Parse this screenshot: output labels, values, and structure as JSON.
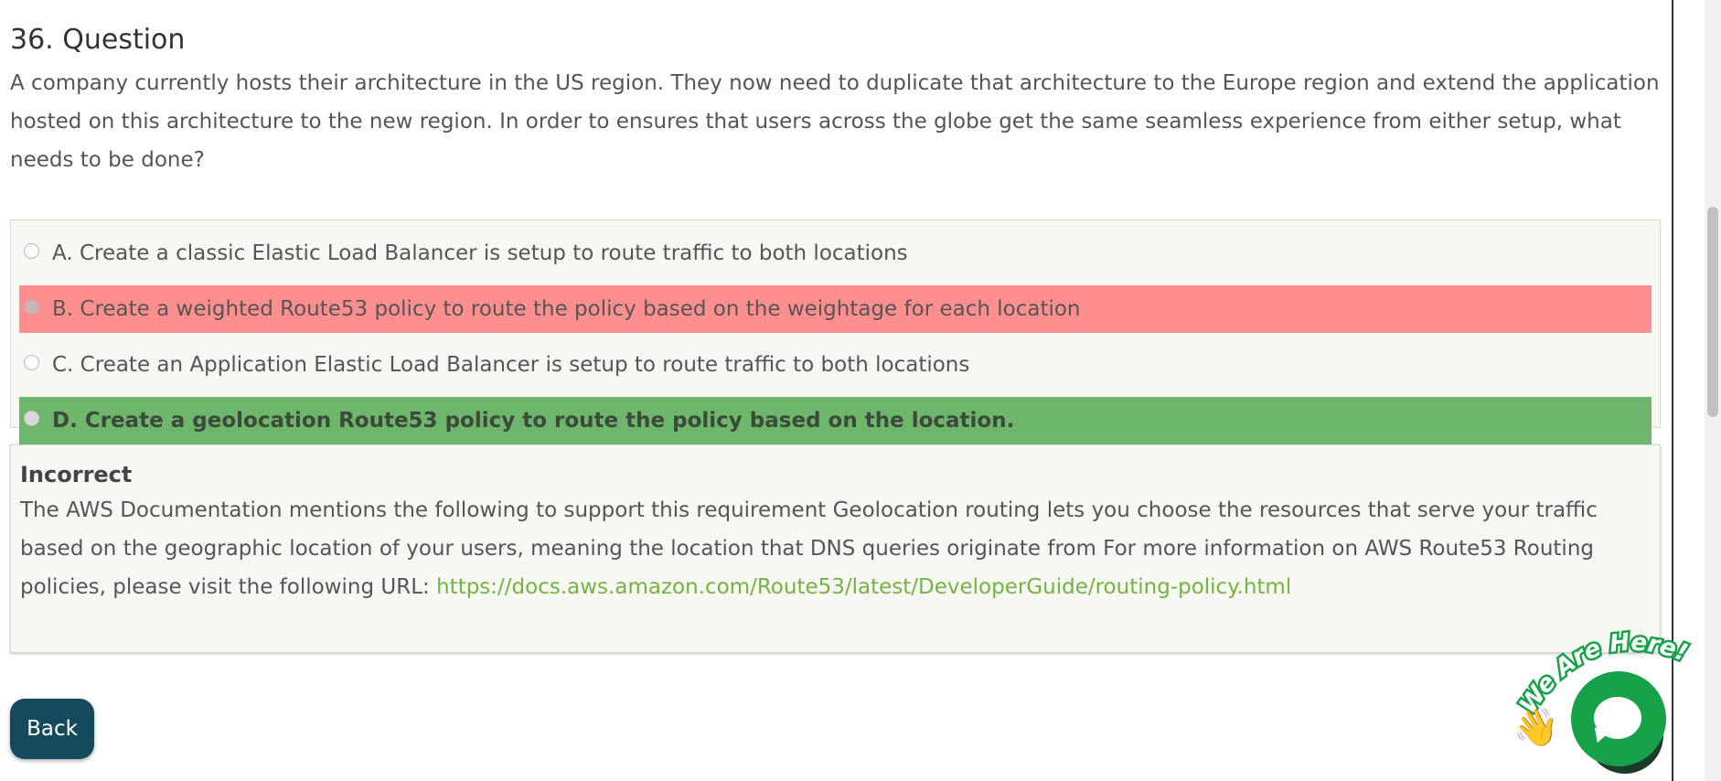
{
  "question": {
    "title": "36. Question",
    "text": "A company currently hosts their architecture in the US region. They now need to duplicate that architecture to the Europe region and extend the application hosted on this architecture to the new region. In order to ensures that users across the globe get the same seamless experience from either setup, what needs to be done?"
  },
  "options": [
    {
      "label": "A. Create a classic Elastic Load Balancer is setup to route traffic to both locations",
      "state": "neutral"
    },
    {
      "label": "B. Create a weighted Route53 policy to route the policy based on the weightage for each location",
      "state": "wrong"
    },
    {
      "label": "C. Create an Application Elastic Load Balancer is setup to route traffic to both locations",
      "state": "neutral"
    },
    {
      "label": "D. Create a geolocation Route53 policy to route the policy based on the location.",
      "state": "correct"
    }
  ],
  "feedback": {
    "title": "Incorrect",
    "text": "The AWS Documentation mentions the following to support this requirement Geolocation routing lets you choose the resources that serve your traffic based on the geographic location of your users, meaning the location that DNS queries originate from For more information on AWS Route53 Routing policies, please visit the following URL: ",
    "link": "https://docs.aws.amazon.com/Route53/latest/DeveloperGuide/routing-policy.html"
  },
  "back_button": {
    "label": "Back"
  },
  "chat_widget": {
    "tagline": "We Are Here!",
    "icon": "chat-bubble-icon",
    "hand_icon": "waving-hand-icon"
  },
  "colors": {
    "wrong": "#ff8f8f",
    "correct": "#6db66c",
    "link": "#73b33f",
    "back_button": "#144b5c",
    "chat": "#17a24a"
  }
}
